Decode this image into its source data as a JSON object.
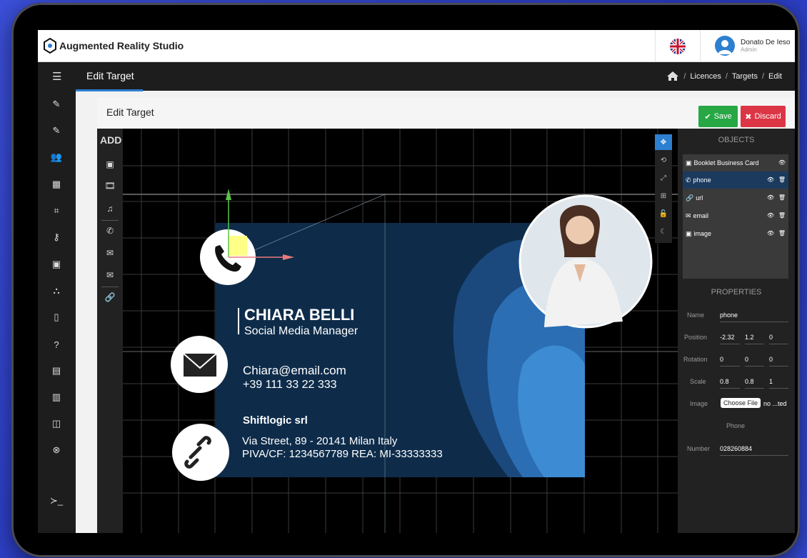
{
  "app": {
    "title": "Augmented Reality Studio"
  },
  "user": {
    "name": "Donato De Ieso",
    "role": "Admin"
  },
  "subbar": {
    "title": "Edit Target"
  },
  "breadcrumb": {
    "items": [
      "Licences",
      "Targets",
      "Edit"
    ]
  },
  "card": {
    "title": "Edit Target",
    "save_label": "Save",
    "discard_label": "Discard"
  },
  "toolbox": {
    "add_label": "ADD"
  },
  "objects": {
    "title": "OBJECTS",
    "items": [
      {
        "label": "Booklet Business Card",
        "icon": "image-icon"
      },
      {
        "label": "phone",
        "icon": "phone-icon"
      },
      {
        "label": "url",
        "icon": "link-icon"
      },
      {
        "label": "email",
        "icon": "envelope-icon"
      },
      {
        "label": "image",
        "icon": "image-icon"
      }
    ]
  },
  "properties": {
    "title": "PROPERTIES",
    "name_label": "Name",
    "name_value": "phone",
    "position_label": "Position",
    "position": [
      "-2.32",
      "1.2",
      "0"
    ],
    "rotation_label": "Rotation",
    "rotation": [
      "0",
      "0",
      "0"
    ],
    "scale_label": "Scale",
    "scale": [
      "0.8",
      "0.8",
      "1"
    ],
    "image_label": "Image",
    "choose_file": "Choose File",
    "file_status": "no ...ted",
    "phone_section": "Phone",
    "number_label": "Number",
    "number_value": "028260884"
  },
  "business_card": {
    "name": "CHIARA BELLI",
    "role": "Social Media Manager",
    "email": "Chiara@email.com",
    "phone": "+39 111 33 22 333",
    "company": "Shiftlogic srl",
    "address": "Via Street, 89 - 20141 Milan Italy",
    "vat": "PIVA/CF: 1234567789   REA: MI-33333333"
  },
  "colors": {
    "accent": "#2d7fd0",
    "save": "#28a745",
    "discard": "#dc3545",
    "card_bg": "#0e2c4a"
  }
}
